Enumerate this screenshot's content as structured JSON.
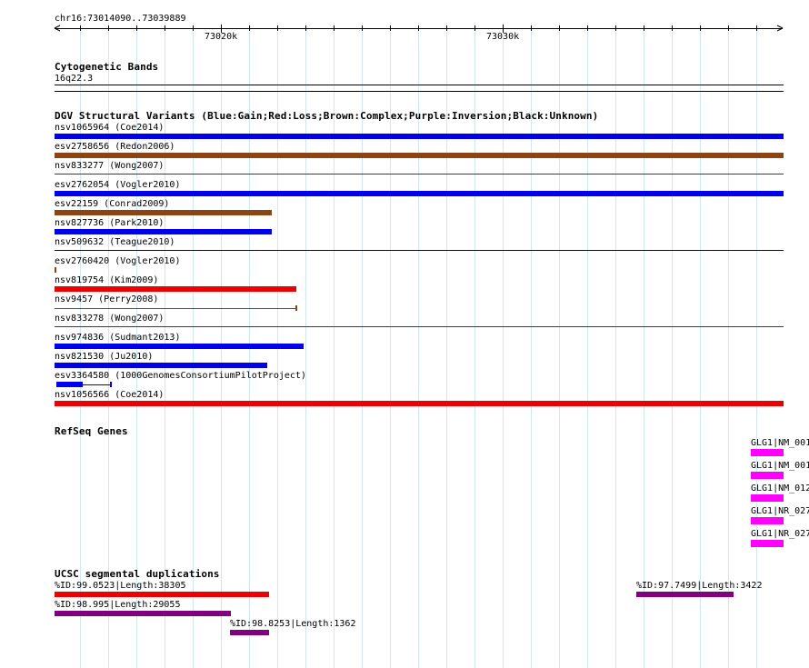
{
  "ruler": {
    "location": "chr16:73014090..73039889",
    "ticks": [
      "73020k",
      "73030k"
    ]
  },
  "cytoband": {
    "title": "Cytogenetic Bands",
    "band": "16q22.3"
  },
  "dgv": {
    "title": "DGV Structural Variants (Blue:Gain;Red:Loss;Brown:Complex;Purple:Inversion;Black:Unknown)",
    "colors": {
      "gain": "#0000ee",
      "loss": "#ee0000",
      "complex": "#8b4513",
      "inversion": "#800080",
      "unknown": "#000000"
    },
    "features": [
      {
        "label": "nsv1065964 (Coe2014)",
        "type": "gain"
      },
      {
        "label": "esv2758656 (Redon2006)",
        "type": "complex"
      },
      {
        "label": "nsv833277 (Wong2007)",
        "type": "loss"
      },
      {
        "label": "esv2762054 (Vogler2010)",
        "type": "gain"
      },
      {
        "label": "esv22159 (Conrad2009)",
        "type": "complex"
      },
      {
        "label": "nsv827736 (Park2010)",
        "type": "gain"
      },
      {
        "label": "nsv509632 (Teague2010)",
        "type": "gain"
      },
      {
        "label": "esv2760420 (Vogler2010)",
        "type": "complex"
      },
      {
        "label": "nsv819754 (Kim2009)",
        "type": "loss"
      },
      {
        "label": "nsv9457 (Perry2008)",
        "type": "complex"
      },
      {
        "label": "nsv833278 (Wong2007)",
        "type": "loss"
      },
      {
        "label": "nsv974836 (Sudmant2013)",
        "type": "gain"
      },
      {
        "label": "nsv821530 (Ju2010)",
        "type": "gain"
      },
      {
        "label": "esv3364580 (1000GenomesConsortiumPilotProject)",
        "type": "gain"
      },
      {
        "label": "nsv1056566 (Coe2014)",
        "type": "loss"
      }
    ]
  },
  "refseq": {
    "title": "RefSeq Genes",
    "color": "#ff00ff",
    "genes": [
      {
        "label": "GLG1|NM_001"
      },
      {
        "label": "GLG1|NM_001"
      },
      {
        "label": "GLG1|NM_012"
      },
      {
        "label": "GLG1|NR_027"
      },
      {
        "label": "GLG1|NR_027"
      }
    ]
  },
  "segdups": {
    "title": "UCSC segmental duplications",
    "features": [
      {
        "label": "%ID:99.0523|Length:38305",
        "color": "#ee0000"
      },
      {
        "label": "%ID:98.995|Length:29055",
        "color": "#800080"
      },
      {
        "label": "%ID:98.8253|Length:1362",
        "color": "#800080"
      },
      {
        "label": "%ID:97.7499|Length:3422",
        "color": "#800080"
      }
    ]
  }
}
